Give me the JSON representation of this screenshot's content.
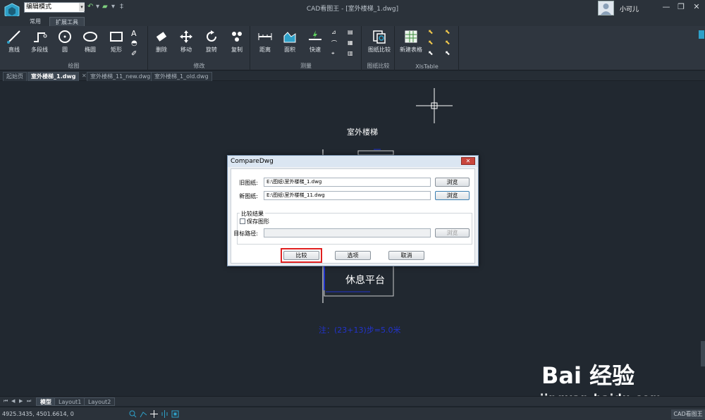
{
  "titlebar": {
    "mode_select": "编辑模式",
    "window_title": "CAD看图王 - [室外楼梯_1.dwg]",
    "user_name": "小可儿"
  },
  "ribbon_tabs": [
    "常用",
    "扩展工具"
  ],
  "ribbon": {
    "groups": {
      "draw": "绘图",
      "modify": "修改",
      "measure": "测量",
      "compare": "图纸比较",
      "xlstable": "XlsTable"
    },
    "tools": {
      "line": "直线",
      "polyline": "多段线",
      "circle": "圆",
      "ellipse": "椭圆",
      "rect": "矩形",
      "delete": "删除",
      "move": "移动",
      "rotate": "旋转",
      "copy": "复制",
      "distance": "距离",
      "area": "面积",
      "quick": "快速",
      "compare": "图纸比较",
      "new_table": "新建表格"
    }
  },
  "doc_tabs": [
    "起始页",
    "室外楼梯_1.dwg",
    "室外楼梯_11_new.dwg",
    "室外楼梯_1_old.dwg"
  ],
  "canvas": {
    "text_title": "室外楼梯",
    "text_platform": "休息平台",
    "text_note": "注：(23+13)步=5.0米"
  },
  "dialog": {
    "title": "CompareDwg",
    "old_label": "旧图纸:",
    "old_value": "E:\\图纸\\室外楼梯_1.dwg",
    "new_label": "新图纸:",
    "new_value": "E:\\图纸\\室外楼梯_11.dwg",
    "browse": "浏览",
    "result_group": "比较结果",
    "save_checkbox": "保存图形",
    "target_label": "目标路径:",
    "target_value": "",
    "compare_btn": "比较",
    "options_btn": "选项",
    "cancel_btn": "取消"
  },
  "layout_tabs": [
    "模型",
    "Layout1",
    "Layout2"
  ],
  "status": {
    "coords": "4925.3435, 4501.6614, 0",
    "app_name": "CAD看图王"
  },
  "watermark": {
    "brand": "Bai 经验",
    "domain": "jingyan.baidu.com"
  },
  "colors": {
    "canvas_bg": "#212830",
    "ribbon_bg": "#2f363f",
    "highlight": "#e02020",
    "cad_blue": "#2233cc"
  }
}
